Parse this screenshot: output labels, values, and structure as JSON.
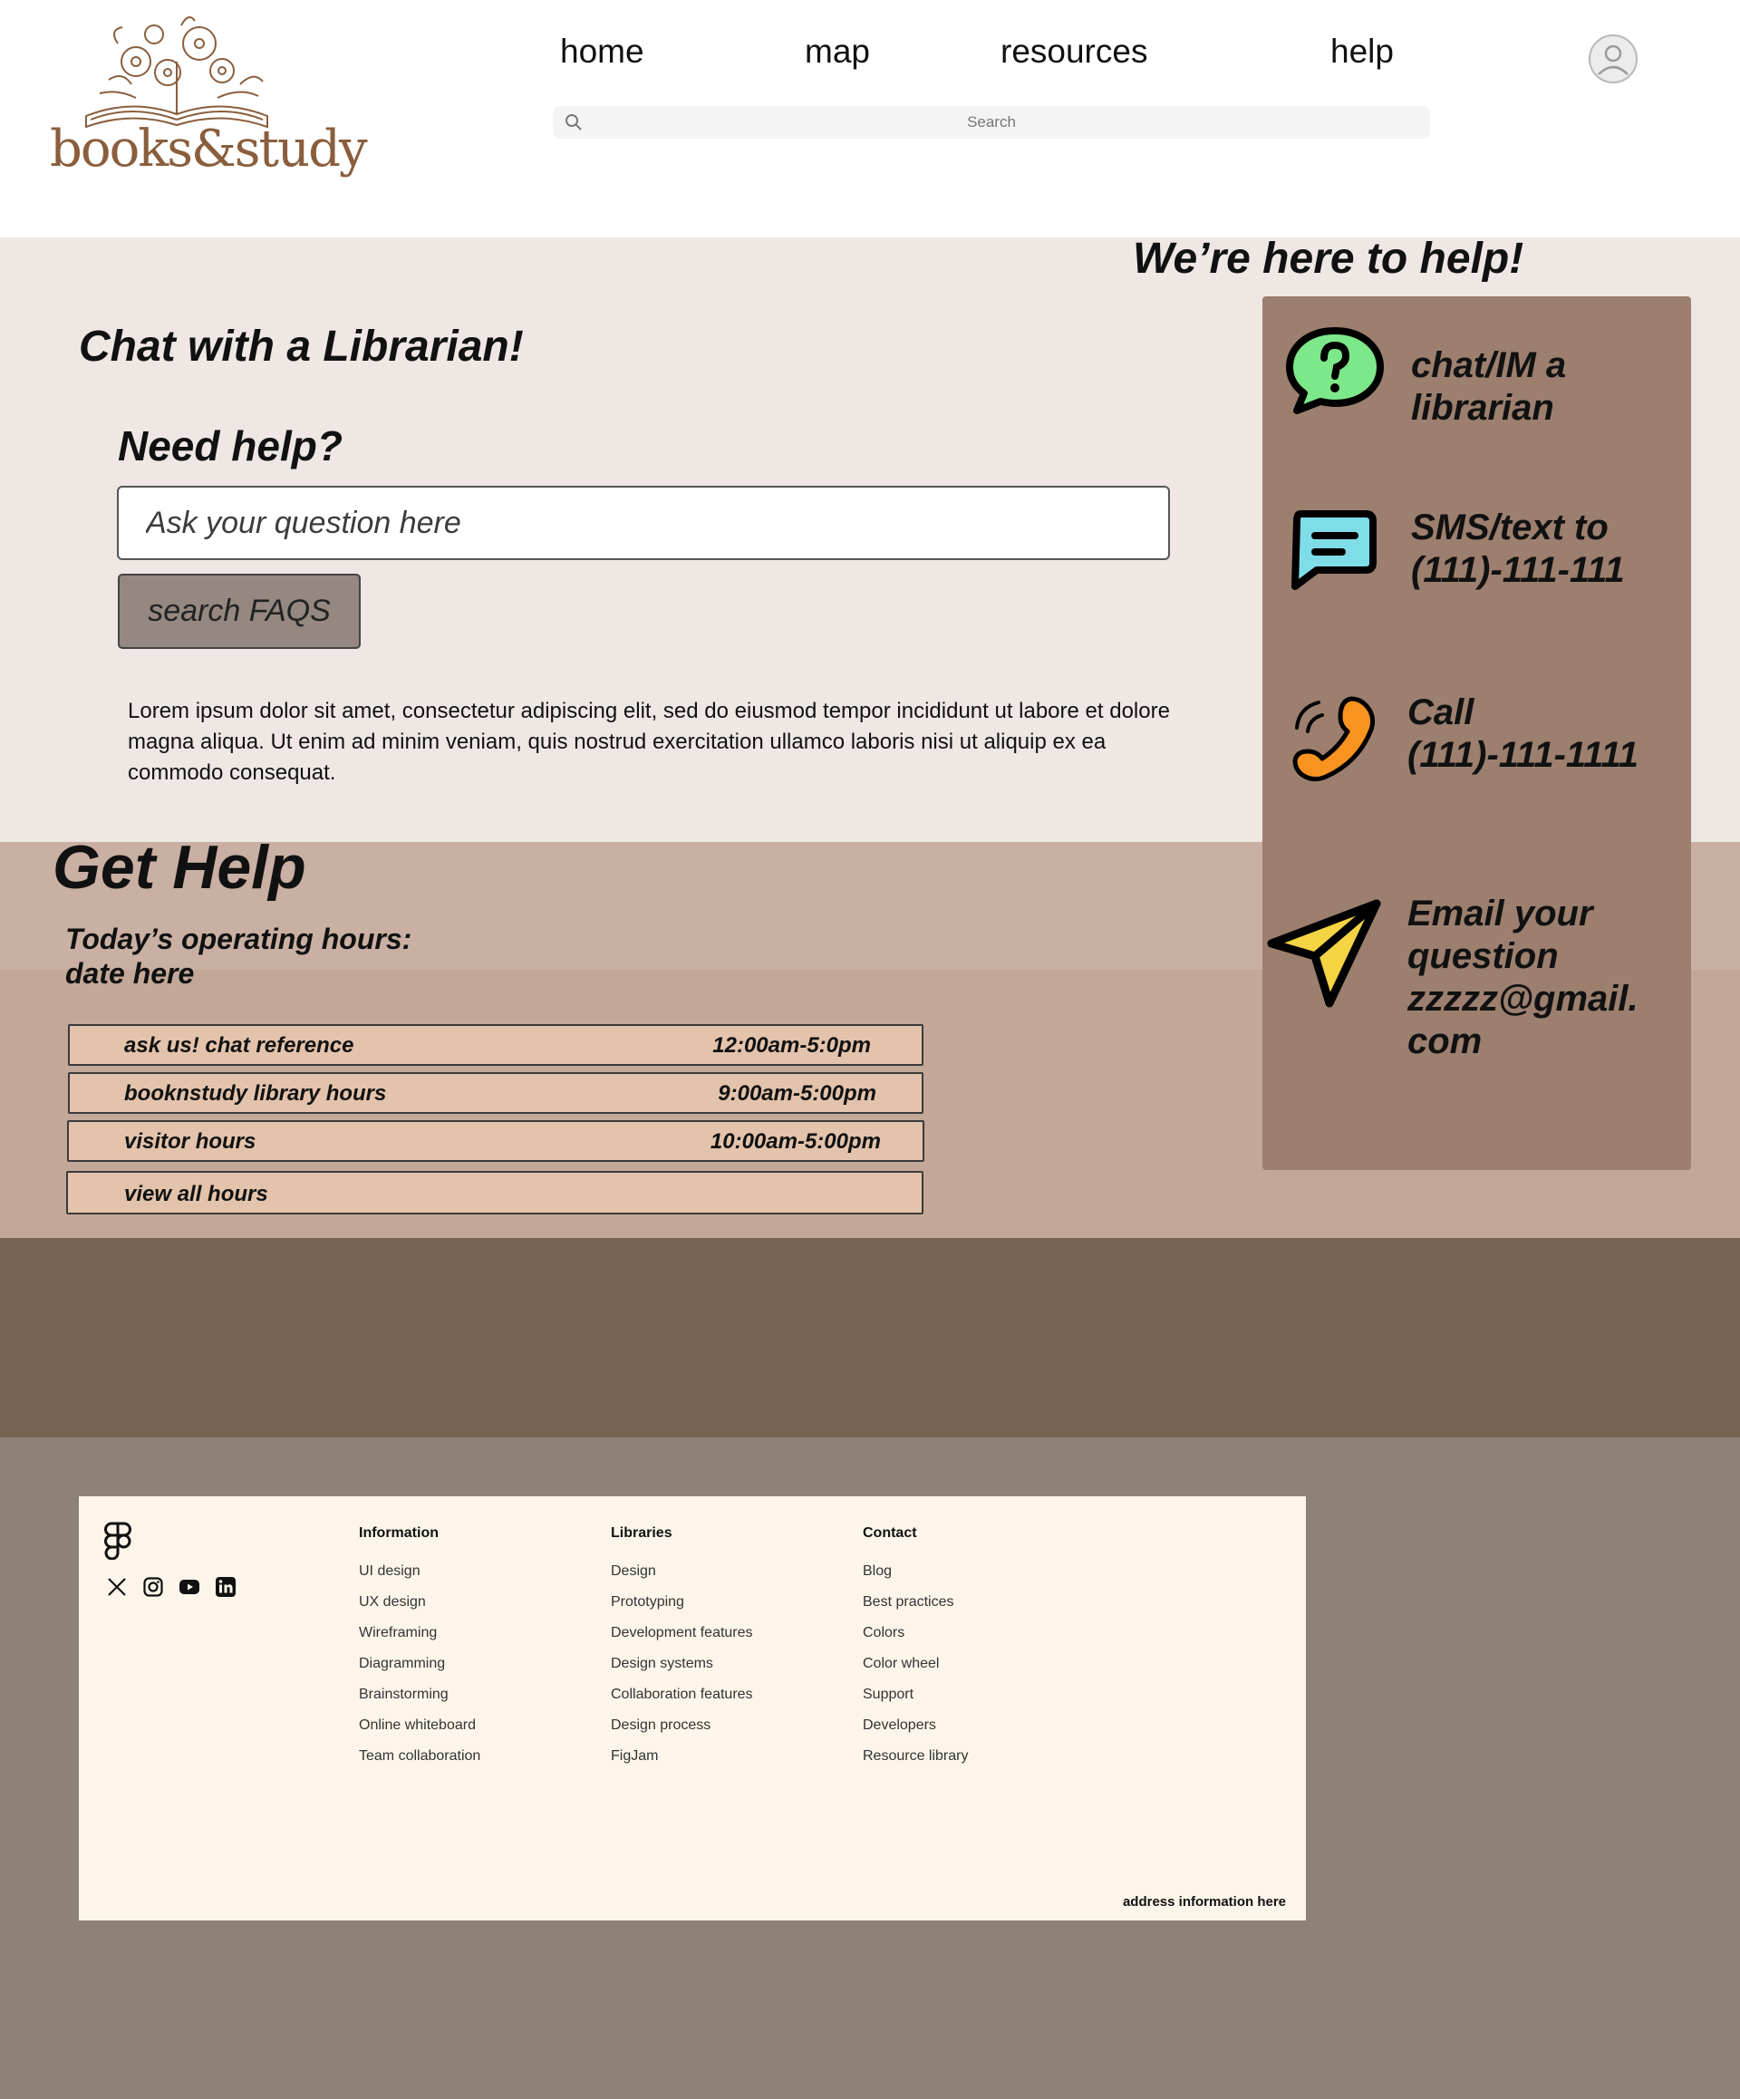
{
  "brand": {
    "logo_text": "books&study"
  },
  "nav": {
    "items": [
      {
        "label": "home"
      },
      {
        "label": "map"
      },
      {
        "label": "resources"
      },
      {
        "label": "help"
      }
    ]
  },
  "search": {
    "placeholder": "Search"
  },
  "chat": {
    "title": "Chat with a Librarian!",
    "need_help": "Need help?",
    "question_placeholder": "Ask your question here",
    "faq_button": "search FAQS",
    "body": "Lorem ipsum dolor sit amet, consectetur adipiscing elit, sed do eiusmod tempor incididunt ut labore et dolore magna aliqua. Ut enim ad minim veniam, quis nostrud exercitation ullamco laboris nisi ut aliquip ex ea commodo consequat."
  },
  "get_help": {
    "title": "Get Help",
    "hours_line1": "Today’s operating hours:",
    "hours_line2": "date here",
    "rows": [
      {
        "label": "ask us! chat reference",
        "time": "12:00am-5:0pm"
      },
      {
        "label": "booknstudy library hours",
        "time": "9:00am-5:00pm"
      },
      {
        "label": "visitor hours",
        "time": "10:00am-5:00pm"
      },
      {
        "label": "view all hours",
        "time": ""
      }
    ]
  },
  "contact_panel": {
    "title": "We’re here to help!",
    "items": [
      {
        "line1": "chat/IM a",
        "line2": "librarian",
        "icon": "question-bubble-icon"
      },
      {
        "line1": "SMS/text to",
        "line2": "(111)-111-111",
        "icon": "message-icon"
      },
      {
        "line1": "Call",
        "line2": "(111)-111-1111",
        "icon": "phone-icon"
      },
      {
        "line1": "Email your",
        "line2": "question",
        "line3": "zzzzz@gmail.",
        "line4": "com",
        "icon": "send-icon"
      }
    ],
    "colors": {
      "panel": "#9c7f6e",
      "chat_icon": "#7de88a",
      "sms_icon": "#7fdde8",
      "phone_icon": "#f7931e",
      "send_icon": "#f5d443"
    }
  },
  "footer": {
    "columns": [
      {
        "title": "Information",
        "links": [
          "UI design",
          "UX design",
          "Wireframing",
          "Diagramming",
          "Brainstorming",
          "Online whiteboard",
          "Team collaboration"
        ]
      },
      {
        "title": "Libraries",
        "links": [
          "Design",
          "Prototyping",
          "Development features",
          "Design systems",
          "Collaboration features",
          "Design process",
          "FigJam"
        ]
      },
      {
        "title": "Contact",
        "links": [
          "Blog",
          "Best practices",
          "Colors",
          "Color wheel",
          "Support",
          "Developers",
          "Resource library"
        ]
      }
    ],
    "social": [
      "x-icon",
      "instagram-icon",
      "youtube-icon",
      "linkedin-icon"
    ],
    "address": "address information here"
  }
}
